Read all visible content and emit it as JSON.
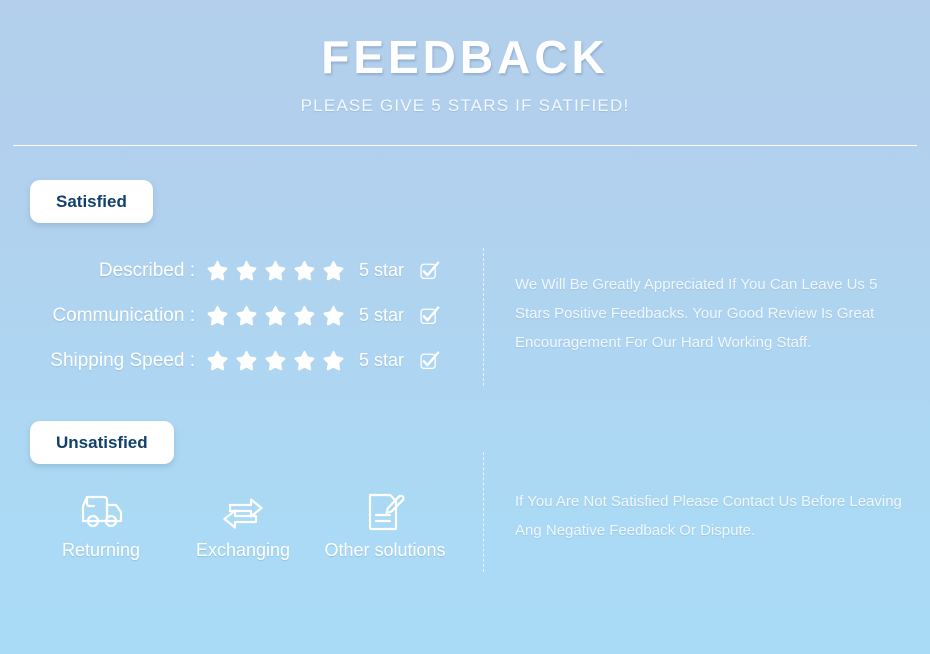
{
  "header": {
    "title": "FEEDBACK",
    "subtitle": "PLEASE GIVE 5 STARS IF SATIFIED!"
  },
  "satisfied": {
    "pill_label": "Satisfied",
    "ratings": [
      {
        "label": "Described :",
        "stars": 5,
        "count_label": "5 star",
        "checked": true
      },
      {
        "label": "Communication :",
        "stars": 5,
        "count_label": "5 star",
        "checked": true
      },
      {
        "label": "Shipping Speed :",
        "stars": 5,
        "count_label": "5 star",
        "checked": true
      }
    ],
    "note": "We Will Be Greatly Appreciated If You Can Leave Us 5 Stars Positive Feedbacks. Your Good Review Is Great Encouragement For Our Hard Working Staff."
  },
  "unsatisfied": {
    "pill_label": "Unsatisfied",
    "options": [
      {
        "label": "Returning",
        "icon": "truck-icon"
      },
      {
        "label": "Exchanging",
        "icon": "exchange-arrows-icon"
      },
      {
        "label": "Other solutions",
        "icon": "document-pencil-icon"
      }
    ],
    "note": "If You Are Not Satisfied Please Contact Us Before Leaving Ang Negative Feedback Or Dispute."
  },
  "colors": {
    "background_top": "#b3cfeb",
    "background_bottom": "#a9dbf6",
    "pill_background": "#ffffff",
    "pill_text": "#12406b",
    "text_white": "#ffffff",
    "divider": "#ffffff"
  }
}
